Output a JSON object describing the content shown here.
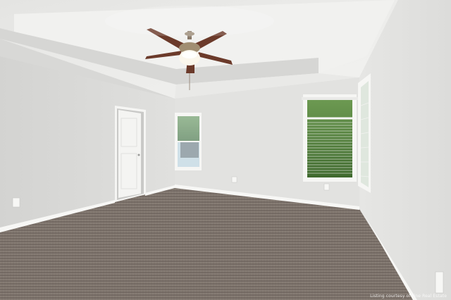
{
  "photo": {
    "subject": "empty-bedroom",
    "watermark": "Listing courtesy of Fine Real Estate",
    "colors": {
      "ceiling": "#efefed",
      "wall_left": "#d9d9d7",
      "wall_back": "#e3e3e1",
      "wall_right": "#e8e8e6",
      "carpet": "#7d736b",
      "trim": "#f7f7f5",
      "fan_blade": "#6b3a2a",
      "greenery": "#4f7a3b"
    }
  }
}
